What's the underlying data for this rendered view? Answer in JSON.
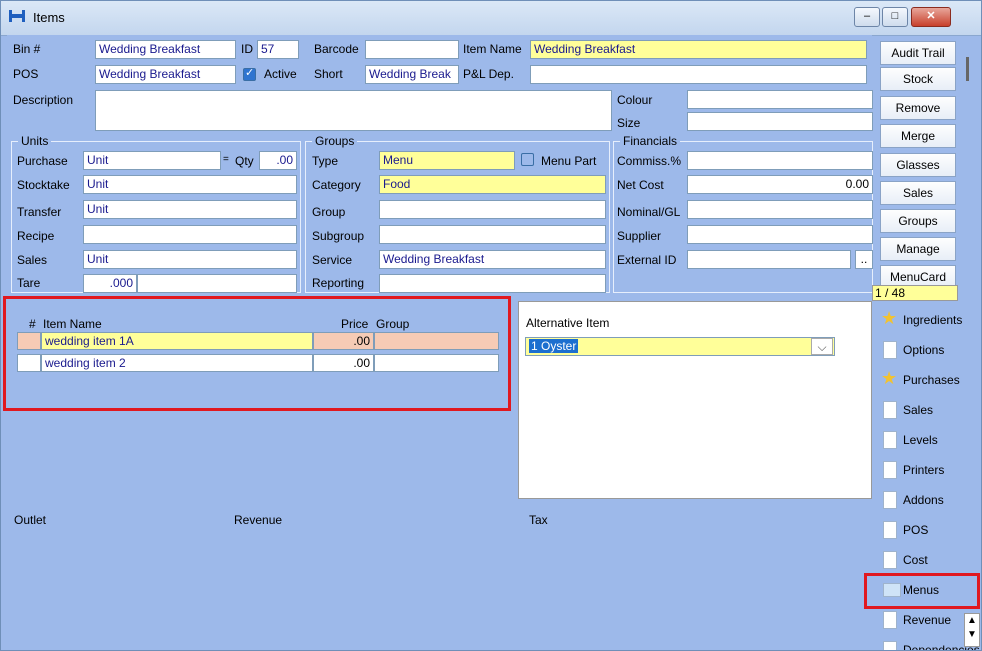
{
  "window": {
    "title": "Items",
    "controls": {
      "minimize": "–",
      "maximize": "□",
      "close": "✕"
    }
  },
  "fields": {
    "bin_label": "Bin #",
    "bin_value": "Wedding Breakfast",
    "id_label": "ID",
    "id_value": "57",
    "barcode_label": "Barcode",
    "barcode_value": "",
    "item_name_label": "Item Name",
    "item_name_value": "Wedding Breakfast",
    "pos_label": "POS",
    "pos_value": "Wedding Breakfast",
    "active_label": "Active",
    "short_label": "Short",
    "short_value": "Wedding Break",
    "pl_label": "P&L Dep.",
    "pl_value": "",
    "description_label": "Description",
    "description_value": "",
    "colour_label": "Colour",
    "size_label": "Size"
  },
  "units": {
    "title": "Units",
    "purchase_label": "Purchase",
    "purchase_value": "Unit",
    "qty_label": "Qty",
    "qty_value": ".00",
    "stocktake_label": "Stocktake",
    "stocktake_value": "Unit",
    "transfer_label": "Transfer",
    "transfer_value": "Unit",
    "recipe_label": "Recipe",
    "recipe_value": "",
    "sales_label": "Sales",
    "sales_value": "Unit",
    "tare_label": "Tare",
    "tare_value": ".000"
  },
  "groups": {
    "title": "Groups",
    "type_label": "Type",
    "type_value": "Menu",
    "menu_part_label": "Menu Part",
    "category_label": "Category",
    "category_value": "Food",
    "group_label": "Group",
    "group_value": "",
    "subgroup_label": "Subgroup",
    "subgroup_value": "",
    "service_label": "Service",
    "service_value": "Wedding Breakfast",
    "reporting_label": "Reporting",
    "reporting_value": ""
  },
  "financials": {
    "title": "Financials",
    "commiss_label": "Commiss.%",
    "commiss_value": "",
    "net_cost_label": "Net Cost",
    "net_cost_value": "0.00",
    "nominal_label": "Nominal/GL",
    "nominal_value": "",
    "supplier_label": "Supplier",
    "supplier_value": "",
    "external_label": "External ID",
    "external_value": "",
    "external_btn": ".."
  },
  "right_buttons": [
    "Audit Trail",
    "Stock",
    "Remove",
    "Merge",
    "Glasses",
    "Sales",
    "Groups",
    "Manage",
    "MenuCard"
  ],
  "record_counter": "1 / 48",
  "items_grid": {
    "headers": {
      "num": "#",
      "name": "Item Name",
      "price": "Price",
      "group": "Group"
    },
    "rows": [
      {
        "name": "wedding item 1A",
        "price": ".00",
        "group": ""
      },
      {
        "name": "wedding item 2",
        "price": ".00",
        "group": ""
      }
    ]
  },
  "alternative": {
    "label": "Alternative Item",
    "value": "1 Oyster"
  },
  "bottom_headers": {
    "outlet": "Outlet",
    "revenue": "Revenue",
    "tax": "Tax"
  },
  "tabs": [
    {
      "label": "Ingredients",
      "icon": "star-icon"
    },
    {
      "label": "Options",
      "icon": "page-icon"
    },
    {
      "label": "Purchases",
      "icon": "star-icon"
    },
    {
      "label": "Sales",
      "icon": "page-icon"
    },
    {
      "label": "Levels",
      "icon": "page-icon"
    },
    {
      "label": "Printers",
      "icon": "page-icon"
    },
    {
      "label": "Addons",
      "icon": "page-icon"
    },
    {
      "label": "POS",
      "icon": "page-icon"
    },
    {
      "label": "Cost",
      "icon": "page-icon"
    },
    {
      "label": "Menus",
      "icon": "menu-card-icon"
    },
    {
      "label": "Revenue",
      "icon": "page-icon"
    },
    {
      "label": "Dependencies",
      "icon": "page-icon"
    }
  ]
}
